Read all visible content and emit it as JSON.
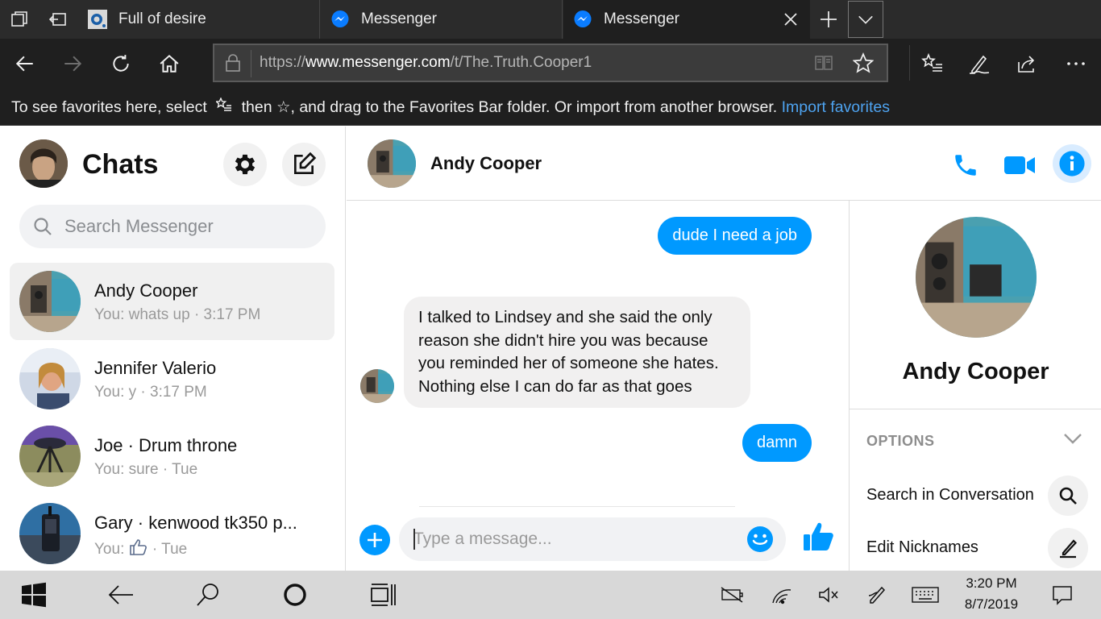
{
  "browser": {
    "tabs": [
      {
        "title": "Full of desire",
        "active": false
      },
      {
        "title": "Messenger",
        "active": false
      },
      {
        "title": "Messenger",
        "active": true
      }
    ],
    "url_prefix": "https://",
    "url_host": "www.messenger.com",
    "url_path": "/t/The.Truth.Cooper1",
    "favorites_bar": {
      "text_a": "To see favorites here, select",
      "text_b": "then ☆, and drag to the Favorites Bar folder. Or import from another browser.",
      "import_link": "Import favorites"
    }
  },
  "sidebar": {
    "title": "Chats",
    "search_placeholder": "Search Messenger",
    "conversations": [
      {
        "name": "Andy Cooper",
        "preview": "You: whats up · 3:17 PM",
        "selected": true
      },
      {
        "name": "Jennifer Valerio",
        "preview": "You: y · 3:17 PM",
        "selected": false
      },
      {
        "name": "Joe · Drum throne",
        "preview": "You: sure · Tue",
        "selected": false
      },
      {
        "name": "Gary · kenwood tk350 p...",
        "preview_prefix": "You:",
        "preview_icon": "thumbs-up-icon",
        "preview_suffix": "· Tue",
        "selected": false
      }
    ]
  },
  "chat": {
    "contact_name": "Andy Cooper",
    "messages": [
      {
        "direction": "out",
        "text": "dude I need a job"
      },
      {
        "direction": "in",
        "text": "I talked to Lindsey and she said the only reason she didn't hire you was because you reminded her of someone she hates. Nothing else I can do far as that goes"
      },
      {
        "direction": "out",
        "text": "damn"
      }
    ],
    "input_placeholder": "Type a message...",
    "accent_color": "#0099ff"
  },
  "info_panel": {
    "name": "Andy Cooper",
    "options_label": "OPTIONS",
    "options": [
      {
        "label": "Search in Conversation",
        "icon": "search-icon"
      },
      {
        "label": "Edit Nicknames",
        "icon": "pencil-icon"
      }
    ]
  },
  "taskbar": {
    "time": "3:20 PM",
    "date": "8/7/2019"
  }
}
